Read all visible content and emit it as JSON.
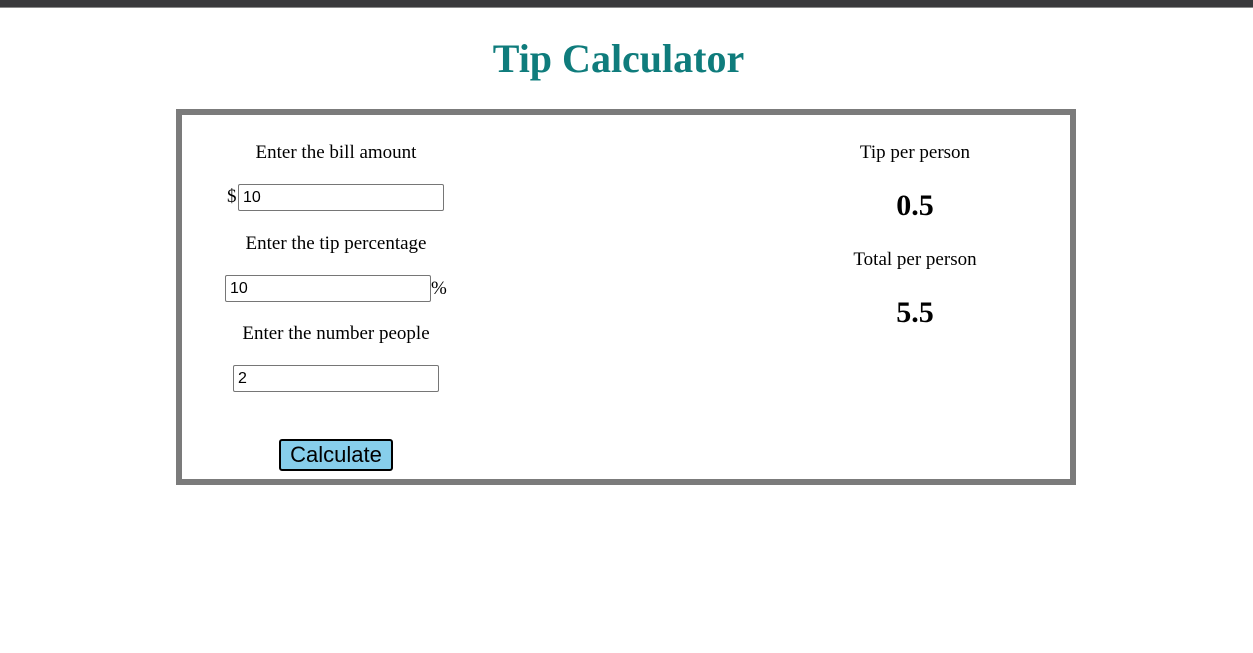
{
  "app": {
    "title": "Tip Calculator"
  },
  "inputs": {
    "bill": {
      "label": "Enter the bill amount",
      "prefix": "$",
      "value": "10"
    },
    "tip": {
      "label": "Enter the tip percentage",
      "suffix": "%",
      "value": "10"
    },
    "people": {
      "label": "Enter the number people",
      "value": "2"
    }
  },
  "actions": {
    "calculate_label": "Calculate"
  },
  "results": {
    "tip_label": "Tip per person",
    "tip_value": "0.5",
    "total_label": "Total per person",
    "total_value": "5.5"
  },
  "colors": {
    "title": "#0f7c7c",
    "button": "#87ceeb",
    "border": "#7b7b7b"
  }
}
